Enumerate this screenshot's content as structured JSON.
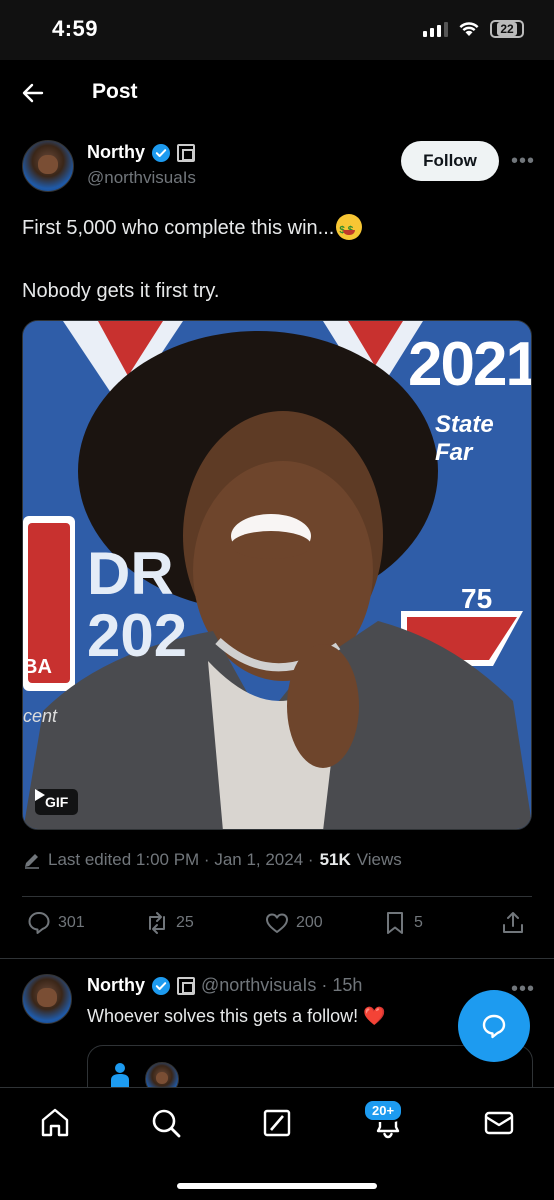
{
  "status_bar": {
    "time": "4:59",
    "battery": "22"
  },
  "header": {
    "title": "Post",
    "back_icon": "arrow-left-icon"
  },
  "post": {
    "author_name": "Northy",
    "author_handle": "@northvisuaIs",
    "follow_label": "Follow",
    "more_label": "•••",
    "text_line1": "First 5,000 who complete this win...",
    "text_line2": "Nobody gets it first try.",
    "media_badge": "GIF",
    "media_year": "2021",
    "media_sponsor": "State Far",
    "media_badge_75": "75",
    "media_draft": "DR",
    "media_draft_year": "202",
    "media_ba": "BA",
    "media_cent": "cent",
    "edit_text": "Last edited 1:00 PM · Jan 1, 2024 ·",
    "views_count": "51K",
    "views_label": "Views",
    "replies": "301",
    "reposts": "25",
    "likes": "200",
    "bookmarks": "5"
  },
  "reply": {
    "author_name": "Northy",
    "handle_time": "@northvisuaIs · 15h",
    "text": "Whoever solves this gets a follow!",
    "heart": "❤️",
    "more_label": "•••"
  },
  "nav": {
    "items": [
      "home-icon",
      "search-icon",
      "grok-icon",
      "notifications-icon",
      "messages-icon"
    ],
    "badge": "20+"
  },
  "colors": {
    "accent": "#1d9bf0",
    "background": "#000000",
    "muted": "#71767b",
    "media_blue": "#2f5da8"
  }
}
